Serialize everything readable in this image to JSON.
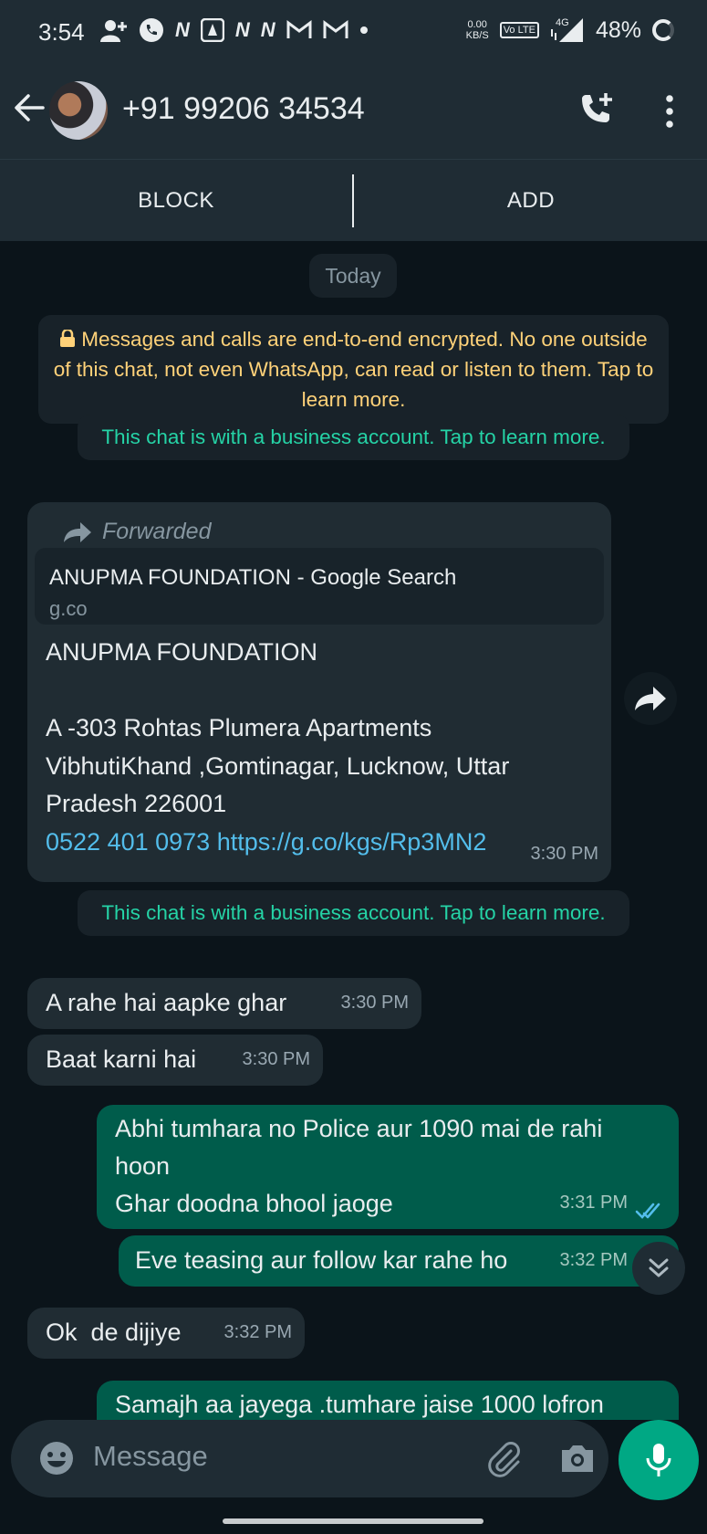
{
  "status_bar": {
    "time": "3:54",
    "notif_icons": [
      "add-user-icon",
      "phone-icon",
      "n-icon",
      "drive-icon",
      "n-icon",
      "n-icon",
      "gmail-icon",
      "gmail-icon",
      "dot-icon"
    ],
    "net_speed": "0.00",
    "net_unit": "KB/S",
    "volte": "Vo LTE",
    "network": "4G",
    "battery": "48%"
  },
  "header": {
    "contact": "+91 99206 34534"
  },
  "actions": {
    "block": "BLOCK",
    "add": "ADD"
  },
  "chat": {
    "date": "Today",
    "encryption_notice": "Messages and calls are end-to-end encrypted. No one outside of this chat, not even WhatsApp, can read or listen to them. Tap to learn more.",
    "business_notice": "This chat is with a business account. Tap to learn more.",
    "forwarded_message": {
      "forwarded_label": "Forwarded",
      "link_title": "ANUPMA FOUNDATION - Google Search",
      "link_domain": "g.co",
      "line1": "ANUPMA FOUNDATION",
      "line2": "A -303 Rohtas Plumera Apartments",
      "line3": "VibhutiKhand ,Gomtinagar, Lucknow, Uttar",
      "line4": "Pradesh 226001",
      "phone": "0522 401 0973",
      "url": "https://g.co/kgs/Rp3MN2",
      "time": "3:30 PM"
    },
    "messages": [
      {
        "text": "A rahe hai aapke ghar",
        "time": "3:30 PM",
        "dir": "in"
      },
      {
        "text": "Baat karni hai",
        "time": "3:30 PM",
        "dir": "in"
      },
      {
        "line1": "Abhi tumhara no Police aur 1090 mai de rahi",
        "line2": "hoon",
        "line3": "Ghar doodna bhool jaoge",
        "time": "3:31 PM",
        "dir": "out"
      },
      {
        "text": "Eve teasing aur follow kar rahe ho",
        "time": "3:32 PM",
        "dir": "out"
      },
      {
        "text": "Ok  de dijiye",
        "time": "3:32 PM",
        "dir": "in"
      },
      {
        "text": "Samajh aa jayega .tumhare jaise 1000 lofron",
        "dir": "out"
      }
    ]
  },
  "input": {
    "placeholder": "Message"
  },
  "colors": {
    "background": "#0b141a",
    "bar": "#1f2c34",
    "incoming": "#202c33",
    "outgoing": "#005c4b",
    "accent": "#00a884",
    "link": "#53bdeb",
    "encryption_text": "#ffd279",
    "business_text": "#25d3a6"
  }
}
